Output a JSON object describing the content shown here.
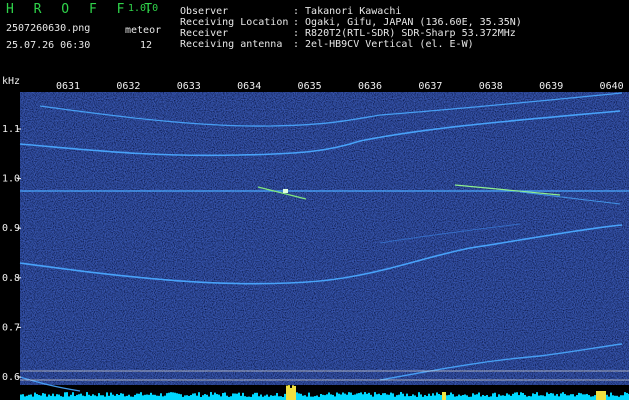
{
  "app": {
    "name": "H R O F F T",
    "version": "1.0.0"
  },
  "file": {
    "name": "2507260630.png",
    "datetime": "25.07.26 06:30"
  },
  "detection": {
    "label": "meteor",
    "count": "12"
  },
  "info": [
    {
      "key": "Observer",
      "value": ": Takanori Kawachi"
    },
    {
      "key": "Receiving Location",
      "value": ": Ogaki, Gifu, JAPAN (136.60E, 35.35N)"
    },
    {
      "key": "Receiver",
      "value": ": R820T2(RTL-SDR) SDR-Sharp 53.372MHz"
    },
    {
      "key": "Receiving antenna",
      "value": ": 2el-HB9CV Vertical (el. E-W)"
    }
  ],
  "axis": {
    "unit": "kHz",
    "time_ticks": [
      "0631",
      "0632",
      "0633",
      "0634",
      "0635",
      "0636",
      "0637",
      "0638",
      "0639",
      "0640"
    ],
    "freq_ticks": [
      "1.1",
      "1.0",
      "0.9",
      "0.8",
      "0.7",
      "0.6"
    ]
  },
  "colors": {
    "background": "#000000",
    "header_text": "#e8e8e8",
    "logo": "#2fd44a",
    "noise": "#0a1e7a",
    "trace": "#4aa8ff",
    "baseline": "#00e0ff"
  }
}
